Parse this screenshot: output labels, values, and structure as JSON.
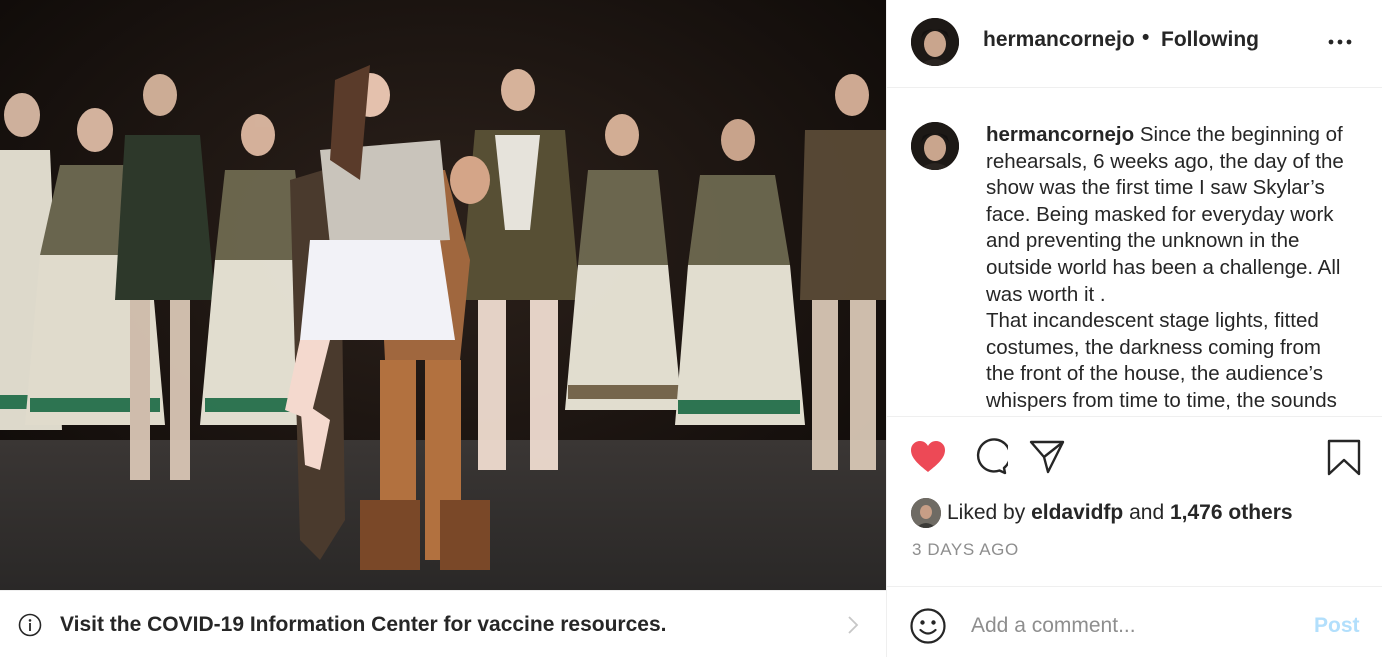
{
  "post": {
    "username": "hermancornejo",
    "separator": "•",
    "follow_status": "Following",
    "more_icon": "more-horizontal-icon"
  },
  "covid_banner": {
    "text": "Visit the COVID-19 Information Center for vaccine resources.",
    "icon": "info-icon"
  },
  "caption": {
    "username": "hermancornejo",
    "lines": [
      "Since the beginning of",
      "rehearsals, 6 weeks ago, the day of the",
      "show was the first time I saw Skylar’s",
      "face. Being masked for everyday work",
      "and preventing the unknown in the",
      "outside world has been a challenge. All",
      "was worth it .",
      "That incandescent stage lights, fitted",
      "costumes, the darkness coming from",
      "the front of the house, the audience’s",
      "whispers from time to time, the sounds"
    ]
  },
  "actions": {
    "liked": true,
    "icons": [
      "heart-icon",
      "comment-icon",
      "share-icon",
      "bookmark-icon"
    ],
    "heart_color": "#ed4956"
  },
  "likes": {
    "prefix": "Liked by",
    "liker": "eldavidfp",
    "conjunction": "and",
    "others": "1,476 others"
  },
  "timestamp": "3 DAYS AGO",
  "comment_box": {
    "placeholder": "Add a comment...",
    "post_label": "Post",
    "post_color": "#b2dffc"
  }
}
